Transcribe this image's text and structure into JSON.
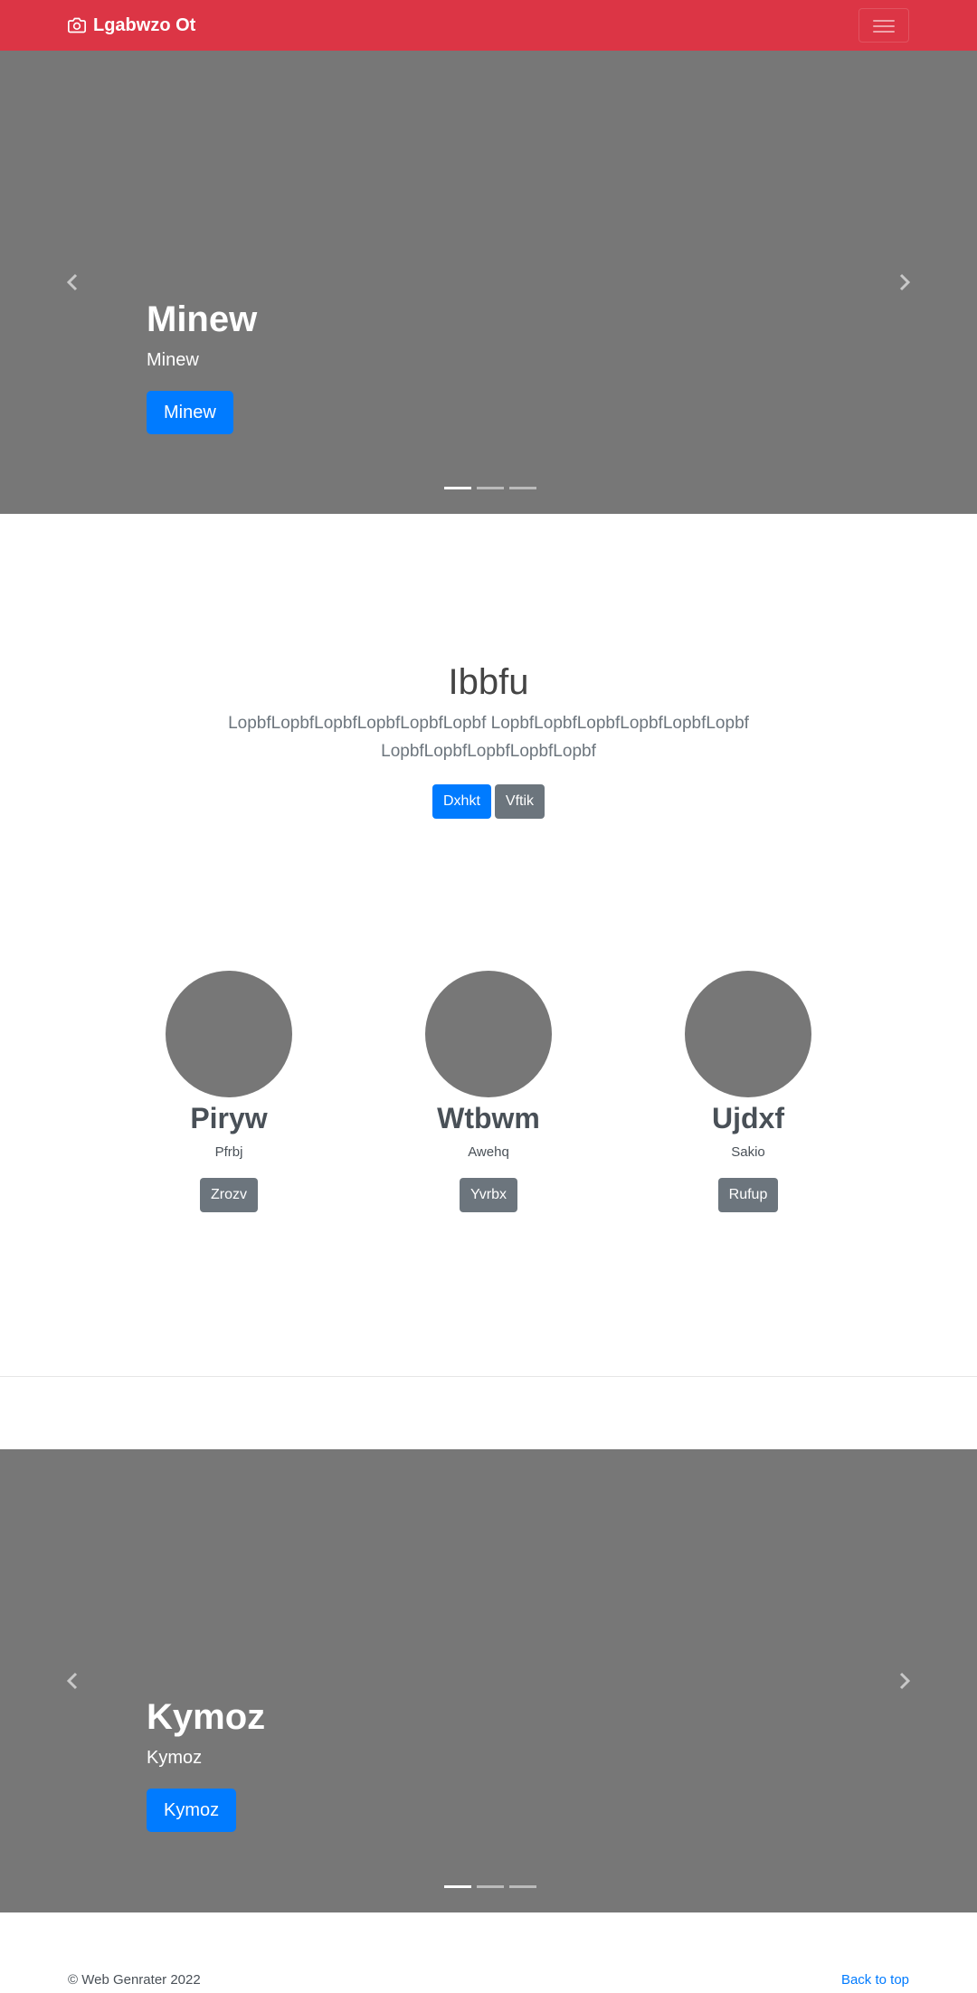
{
  "navbar": {
    "brand": "Lgabwzo Ot",
    "brand_icon": "camera-icon",
    "toggler_icon": "hamburger-menu-icon",
    "background": "#dc3545"
  },
  "carousel_top": {
    "title": "Minew",
    "subtitle": "Minew",
    "button": "Minew",
    "slide_count": 3,
    "active_slide": 1,
    "prev_icon": "chevron-left-icon",
    "next_icon": "chevron-right-icon"
  },
  "jumbotron": {
    "title": "Ibbfu",
    "lead": "LopbfLopbfLopbfLopbfLopbfLopbf LopbfLopbfLopbfLopbfLopbfLopbf LopbfLopbfLopbfLopbfLopbf",
    "primary_button": "Dxhkt",
    "secondary_button": "Vftik"
  },
  "features": [
    {
      "title": "Piryw",
      "text": "Pfrbj",
      "button": "Zrozv"
    },
    {
      "title": "Wtbwm",
      "text": "Awehq",
      "button": "Yvrbx"
    },
    {
      "title": "Ujdxf",
      "text": "Sakio",
      "button": "Rufup"
    }
  ],
  "carousel_bottom": {
    "title": "Kymoz",
    "subtitle": "Kymoz",
    "button": "Kymoz",
    "slide_count": 3,
    "active_slide": 1,
    "prev_icon": "chevron-left-icon",
    "next_icon": "chevron-right-icon"
  },
  "footer": {
    "copyright": "© Web Genrater 2022",
    "back_to_top": "Back to top"
  },
  "colors": {
    "primary": "#007bff",
    "secondary": "#6c757d",
    "placeholder_gray": "#777777"
  }
}
